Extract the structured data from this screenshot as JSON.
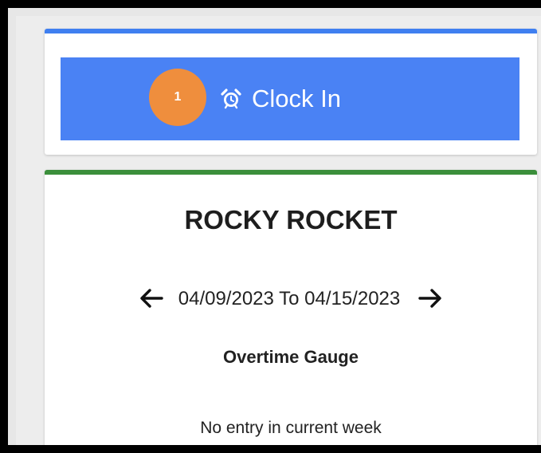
{
  "clock_card": {
    "accent_color": "#3f7ff0",
    "button_color": "#4a82f4",
    "badge": "1",
    "badge_color": "#ef8e3d",
    "icon": "alarm-clock-icon",
    "label": "Clock In"
  },
  "employee_card": {
    "accent_color": "#3b8f3b",
    "name": "ROCKY ROCKET",
    "week": {
      "prev_icon": "arrow-left-icon",
      "range": "04/09/2023 To 04/15/2023",
      "next_icon": "arrow-right-icon"
    },
    "gauge_title": "Overtime Gauge",
    "empty_message": "No entry in current week"
  }
}
